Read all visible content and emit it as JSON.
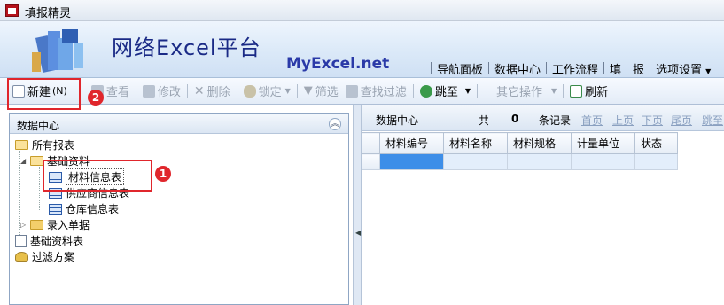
{
  "window": {
    "title": "填报精灵"
  },
  "banner": {
    "title": "网络Excel平台",
    "subtitle": "MyExcel.net",
    "nav": [
      "导航面板",
      "数据中心",
      "工作流程",
      "填　报",
      "选项设置"
    ]
  },
  "toolbar": {
    "new_label": "新建",
    "new_shortcut": "(N)",
    "view_label": "查看",
    "edit_label": "修改",
    "delete_label": "删除",
    "lock_label": "锁定",
    "filter_label": "筛选",
    "find_filter_label": "查找过滤",
    "jump_label": "跳至",
    "other_label": "其它操作",
    "refresh_label": "刷新"
  },
  "left_panel": {
    "header": "数据中心",
    "tree": {
      "all_reports": "所有报表",
      "basic_data": "基础资料",
      "materials": "材料信息表",
      "suppliers": "供应商信息表",
      "warehouse": "仓库信息表",
      "entry_forms": "录入单据",
      "basic_data_table": "基础资料表",
      "filter_scheme": "过滤方案"
    }
  },
  "right_panel": {
    "header_title": "数据中心",
    "total_prefix": "共",
    "total_count": "0",
    "total_suffix": "条记录",
    "first_page": "首页",
    "prev_page": "上页",
    "next_page": "下页",
    "last_page": "尾页",
    "jump_to": "跳至",
    "columns": [
      "材料编号",
      "材料名称",
      "材料规格",
      "计量单位",
      "状态"
    ]
  },
  "annotations": {
    "badge1": "1",
    "badge2": "2"
  },
  "colors": {
    "annotation_red": "#e0262c",
    "banner_title": "#1a2a86",
    "selected_cell": "#3d8ee8"
  }
}
